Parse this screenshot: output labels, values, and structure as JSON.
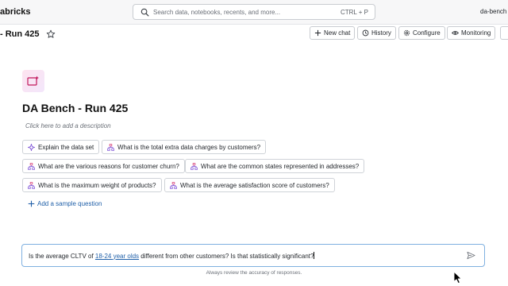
{
  "topbar": {
    "brand": "abricks",
    "search_placeholder": "Search data, notebooks, recents, and more...",
    "search_shortcut": "CTRL + P",
    "workspace": "da-bench"
  },
  "header": {
    "title": "- Run 425",
    "new_chat": "New chat",
    "history": "History",
    "configure": "Configure",
    "monitoring": "Monitoring"
  },
  "space": {
    "title": "DA Bench - Run 425",
    "description_placeholder": "Click here to add a description"
  },
  "suggestions": [
    "Explain the data set",
    "What is the total extra data charges by customers?",
    "What are the various reasons for customer churn?",
    "What are the common states represented in addresses?",
    "What is the maximum weight of products?",
    "What is the average satisfaction score of customers?"
  ],
  "add_sample": "Add a sample question",
  "chat_input": {
    "before_link": "Is the average CLTV of ",
    "link": "18-24 year olds",
    "after_link": " different from other customers? Is that statistically significant?"
  },
  "footer_note": "Always review the accuracy of responses.",
  "colors": {
    "accent": "#1f5fa8",
    "input_border": "#7fb0e0",
    "icon_pink": "#d6336c",
    "icon_purple": "#7b4fd6"
  }
}
